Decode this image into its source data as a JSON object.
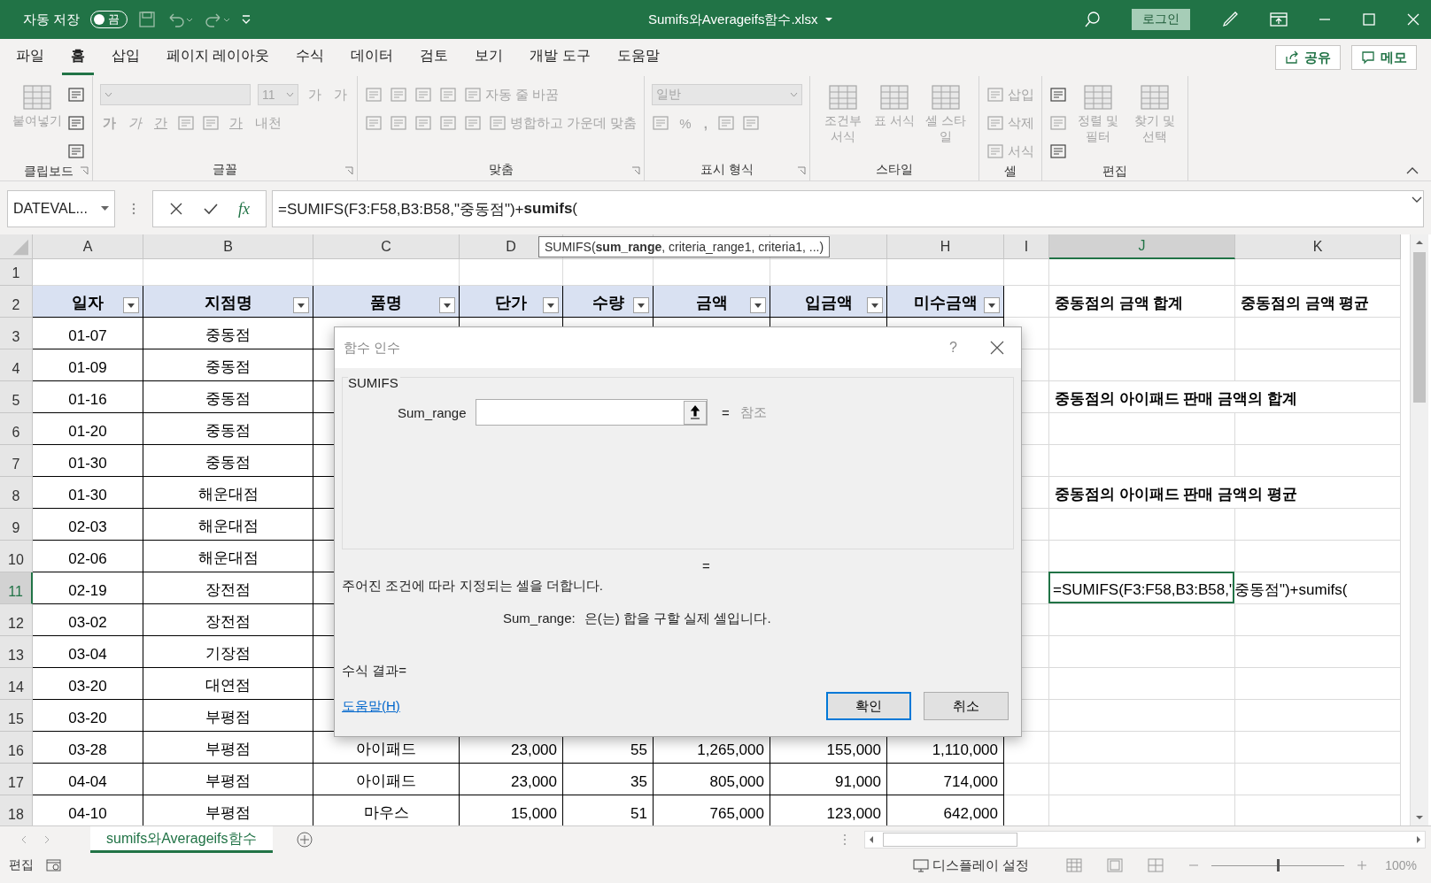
{
  "title_bar": {
    "autosave_label": "자동 저장",
    "autosave_toggle": {
      "label": "끔",
      "on": false
    },
    "file_name": "Sumifs와Averageifs함수.xlsx",
    "login_button": "로그인"
  },
  "menu_tabs": [
    {
      "label": "파일",
      "selected": false
    },
    {
      "label": "홈",
      "selected": true
    },
    {
      "label": "삽입",
      "selected": false
    },
    {
      "label": "페이지 레이아웃",
      "selected": false
    },
    {
      "label": "수식",
      "selected": false
    },
    {
      "label": "데이터",
      "selected": false
    },
    {
      "label": "검토",
      "selected": false
    },
    {
      "label": "보기",
      "selected": false
    },
    {
      "label": "개발 도구",
      "selected": false
    },
    {
      "label": "도움말",
      "selected": false
    }
  ],
  "share_button": "공유",
  "memo_button": "메모",
  "ribbon": [
    {
      "label": "클립보드",
      "launcher": true,
      "sections": [
        {
          "kind": "big",
          "label": "붙여넣기",
          "disabled": true
        },
        {
          "kind": "rows",
          "toolbar_rows": [
            {
              "items": [
                {
                  "kind": "icon",
                  "disabled": false
                }
              ]
            },
            {
              "items": [
                {
                  "kind": "icon",
                  "disabled": false
                }
              ]
            },
            {
              "items": [
                {
                  "kind": "icon",
                  "disabled": false
                }
              ]
            }
          ]
        }
      ]
    },
    {
      "label": "글꼴",
      "launcher": true,
      "sections": [
        {
          "kind": "rows",
          "toolbar_rows": [
            {
              "items": [
                {
                  "kind": "combo",
                  "wide": true,
                  "disabled": true
                },
                {
                  "kind": "combo",
                  "wide": false,
                  "value": "11",
                  "disabled": true
                },
                {
                  "kind": "glyph",
                  "label": "가",
                  "disabled": true
                },
                {
                  "kind": "glyph",
                  "label": "가",
                  "disabled": true
                }
              ]
            },
            {
              "items": [
                {
                  "kind": "bold",
                  "label": "가",
                  "disabled": true
                },
                {
                  "kind": "italic",
                  "label": "가",
                  "disabled": true
                },
                {
                  "kind": "underline",
                  "label": "간",
                  "disabled": true
                },
                {
                  "kind": "icon",
                  "disabled": true
                },
                {
                  "kind": "icon",
                  "disabled": true
                },
                {
                  "kind": "underline",
                  "label": "가",
                  "disabled": true
                },
                {
                  "kind": "glyph",
                  "label": "내천",
                  "disabled": true
                }
              ]
            }
          ]
        }
      ]
    },
    {
      "label": "맞춤",
      "launcher": true,
      "sections": [
        {
          "kind": "rows",
          "toolbar_rows": [
            {
              "items": [
                {
                  "kind": "icon",
                  "disabled": true
                },
                {
                  "kind": "icon",
                  "disabled": true
                },
                {
                  "kind": "icon",
                  "disabled": true
                },
                {
                  "kind": "icon",
                  "disabled": true
                },
                {
                  "kind": "icontext",
                  "label": "자동 줄 바꿈",
                  "disabled": true
                }
              ]
            },
            {
              "items": [
                {
                  "kind": "icon",
                  "disabled": true
                },
                {
                  "kind": "icon",
                  "disabled": true
                },
                {
                  "kind": "icon",
                  "disabled": true
                },
                {
                  "kind": "icon",
                  "disabled": true
                },
                {
                  "kind": "icon",
                  "disabled": true
                },
                {
                  "kind": "icontext",
                  "label": "병합하고 가운데 맞춤",
                  "disabled": true
                }
              ]
            }
          ]
        }
      ]
    },
    {
      "label": "표시 형식",
      "launcher": true,
      "sections": [
        {
          "kind": "rows",
          "toolbar_rows": [
            {
              "items": [
                {
                  "kind": "combo",
                  "wide": true,
                  "value": "일반",
                  "disabled": true
                }
              ]
            },
            {
              "items": [
                {
                  "kind": "icon",
                  "disabled": true
                },
                {
                  "kind": "glyph",
                  "label": "%",
                  "disabled": true
                },
                {
                  "kind": "bold",
                  "label": ",",
                  "disabled": true
                },
                {
                  "kind": "icon",
                  "disabled": true
                },
                {
                  "kind": "icon",
                  "disabled": true
                }
              ]
            }
          ]
        }
      ]
    },
    {
      "label": "스타일",
      "launcher": false,
      "sections": [
        {
          "kind": "big",
          "label": "조건부 서식",
          "disabled": true
        },
        {
          "kind": "big",
          "label": "표 서식",
          "disabled": true
        },
        {
          "kind": "big",
          "label": "셀 스타일",
          "disabled": true
        }
      ]
    },
    {
      "label": "셀",
      "launcher": false,
      "sections": [
        {
          "kind": "rows",
          "toolbar_rows": [
            {
              "items": [
                {
                  "kind": "icontext",
                  "label": "삽입",
                  "disabled": true
                }
              ]
            },
            {
              "items": [
                {
                  "kind": "icontext",
                  "label": "삭제",
                  "disabled": true
                }
              ]
            },
            {
              "items": [
                {
                  "kind": "icontext",
                  "label": "서식",
                  "disabled": true
                }
              ]
            }
          ]
        }
      ]
    },
    {
      "label": "편집",
      "launcher": false,
      "sections": [
        {
          "kind": "rows",
          "toolbar_rows": [
            {
              "items": [
                {
                  "kind": "icon",
                  "disabled": false
                }
              ]
            },
            {
              "items": [
                {
                  "kind": "icon",
                  "disabled": true
                }
              ]
            },
            {
              "items": [
                {
                  "kind": "icon",
                  "disabled": false
                }
              ]
            }
          ]
        },
        {
          "kind": "big",
          "label": "정렬 및 필터",
          "disabled": true
        },
        {
          "kind": "big",
          "label": "찾기 및 선택",
          "disabled": true
        }
      ]
    }
  ],
  "formula_bar": {
    "name_box": "DATEVAL...",
    "fx_label": "fx",
    "formula": "=SUMIFS(F3:F58,B3:B58,\"중동점\")+**sumifs**("
  },
  "tooltip": "SUMIFS(**sum_range**, criteria_range1, criteria1, ...)",
  "columns": [
    {
      "label": "A",
      "selected": false
    },
    {
      "label": "B",
      "selected": false
    },
    {
      "label": "C",
      "selected": false
    },
    {
      "label": "D",
      "selected": false
    },
    {
      "selected": false
    },
    {
      "selected": false
    },
    {
      "selected": false
    },
    {
      "label": "H",
      "selected": false
    },
    {
      "label": "I",
      "selected": false
    },
    {
      "label": "J",
      "selected": true
    },
    {
      "label": "K",
      "selected": false
    }
  ],
  "rows": [
    {
      "label": "1",
      "selected": false,
      "cells": {}
    },
    {
      "label": "2",
      "selected": false,
      "cells": {
        "A": {
          "text": "일자",
          "kind": "header"
        },
        "B": {
          "text": "지점명",
          "kind": "header"
        },
        "C": {
          "text": "품명",
          "kind": "header"
        },
        "D": {
          "text": "단가",
          "kind": "header"
        },
        "E": {
          "text": "수량",
          "kind": "header"
        },
        "F": {
          "text": "금액",
          "kind": "header"
        },
        "G": {
          "text": "입금액",
          "kind": "header"
        },
        "H": {
          "text": "미수금액",
          "kind": "header"
        },
        "J": {
          "text": "중동점의 금액 합계",
          "kind": "label"
        },
        "K": {
          "text": "중동점의 금액 평균",
          "kind": "label"
        }
      }
    },
    {
      "label": "3",
      "selected": false,
      "cells": {
        "A": {
          "text": "01-07",
          "kind": "center"
        },
        "B": {
          "text": "중동점",
          "kind": "center"
        }
      }
    },
    {
      "label": "4",
      "selected": false,
      "cells": {
        "A": {
          "text": "01-09",
          "kind": "center"
        },
        "B": {
          "text": "중동점",
          "kind": "center"
        }
      }
    },
    {
      "label": "5",
      "selected": false,
      "cells": {
        "A": {
          "text": "01-16",
          "kind": "center"
        },
        "B": {
          "text": "중동점",
          "kind": "center"
        },
        "J": {
          "text": "중동점의 아이패드 판매 금액의 합계",
          "kind": "label"
        }
      }
    },
    {
      "label": "6",
      "selected": false,
      "cells": {
        "A": {
          "text": "01-20",
          "kind": "center"
        },
        "B": {
          "text": "중동점",
          "kind": "center"
        }
      }
    },
    {
      "label": "7",
      "selected": false,
      "cells": {
        "A": {
          "text": "01-30",
          "kind": "center"
        },
        "B": {
          "text": "중동점",
          "kind": "center"
        }
      }
    },
    {
      "label": "8",
      "selected": false,
      "cells": {
        "A": {
          "text": "01-30",
          "kind": "center"
        },
        "B": {
          "text": "해운대점",
          "kind": "center"
        },
        "J": {
          "text": "중동점의 아이패드 판매 금액의 평균",
          "kind": "label"
        }
      }
    },
    {
      "label": "9",
      "selected": false,
      "cells": {
        "A": {
          "text": "02-03",
          "kind": "center"
        },
        "B": {
          "text": "해운대점",
          "kind": "center"
        }
      }
    },
    {
      "label": "10",
      "selected": false,
      "cells": {
        "A": {
          "text": "02-06",
          "kind": "center"
        },
        "B": {
          "text": "해운대점",
          "kind": "center"
        }
      }
    },
    {
      "label": "11",
      "selected": true,
      "cells": {
        "A": {
          "text": "02-19",
          "kind": "center"
        },
        "B": {
          "text": "장전점",
          "kind": "center"
        },
        "J": {
          "text": "=SUMIFS(F3:F58,B3:B58,\"중동점\")+sumifs(",
          "kind": "formula"
        }
      }
    },
    {
      "label": "12",
      "selected": false,
      "cells": {
        "A": {
          "text": "03-02",
          "kind": "center"
        },
        "B": {
          "text": "장전점",
          "kind": "center"
        }
      }
    },
    {
      "label": "13",
      "selected": false,
      "cells": {
        "A": {
          "text": "03-04",
          "kind": "center"
        },
        "B": {
          "text": "기장점",
          "kind": "center"
        }
      }
    },
    {
      "label": "14",
      "selected": false,
      "cells": {
        "A": {
          "text": "03-20",
          "kind": "center"
        },
        "B": {
          "text": "대연점",
          "kind": "center"
        }
      }
    },
    {
      "label": "15",
      "selected": false,
      "cells": {
        "A": {
          "text": "03-20",
          "kind": "center"
        },
        "B": {
          "text": "부평점",
          "kind": "center"
        }
      }
    },
    {
      "label": "16",
      "selected": false,
      "cells": {
        "A": {
          "text": "03-28",
          "kind": "center"
        },
        "B": {
          "text": "부평점",
          "kind": "center"
        },
        "C": {
          "text": "아이패드",
          "kind": "center"
        },
        "D": {
          "text": "23,000",
          "kind": "number"
        },
        "E": {
          "text": "55",
          "kind": "number"
        },
        "F": {
          "text": "1,265,000",
          "kind": "number"
        },
        "G": {
          "text": "155,000",
          "kind": "number"
        },
        "H": {
          "text": "1,110,000",
          "kind": "number"
        }
      }
    },
    {
      "label": "17",
      "selected": false,
      "cells": {
        "A": {
          "text": "04-04",
          "kind": "center"
        },
        "B": {
          "text": "부평점",
          "kind": "center"
        },
        "C": {
          "text": "아이패드",
          "kind": "center"
        },
        "D": {
          "text": "23,000",
          "kind": "number"
        },
        "E": {
          "text": "35",
          "kind": "number"
        },
        "F": {
          "text": "805,000",
          "kind": "number"
        },
        "G": {
          "text": "91,000",
          "kind": "number"
        },
        "H": {
          "text": "714,000",
          "kind": "number"
        }
      }
    },
    {
      "label": "18",
      "selected": false,
      "cells": {
        "A": {
          "text": "04-10",
          "kind": "center"
        },
        "B": {
          "text": "부평점",
          "kind": "center"
        },
        "C": {
          "text": "마우스",
          "kind": "center"
        },
        "D": {
          "text": "15,000",
          "kind": "number"
        },
        "E": {
          "text": "51",
          "kind": "number"
        },
        "F": {
          "text": "765,000",
          "kind": "number"
        },
        "G": {
          "text": "123,000",
          "kind": "number"
        },
        "H": {
          "text": "642,000",
          "kind": "number"
        }
      }
    }
  ],
  "dialog": {
    "title": "함수 인수",
    "help": "?",
    "function_name": "SUMIFS",
    "arguments": [
      {
        "label": "Sum_range",
        "equals": "=",
        "result": "참조"
      }
    ],
    "result_equals": "=",
    "description": "주어진 조건에 따라 지정되는 셀을 더합니다.",
    "argument_help": {
      "name": "Sum_range:",
      "text": "은(는) 합을 구할 실제 셀입니다."
    },
    "formula_result": "수식 결과=",
    "help_link": "도움말(H)",
    "buttons": [
      {
        "label": "확인",
        "default": true
      },
      {
        "label": "취소",
        "default": false
      }
    ]
  },
  "sheet_tabs": [
    {
      "label": "sumifs와Averageifs함수",
      "selected": true
    }
  ],
  "status_bar": {
    "mode": "편집",
    "display_settings": "디스플레이 설정",
    "zoom": {
      "level": 0.5,
      "reading": "100%"
    }
  }
}
